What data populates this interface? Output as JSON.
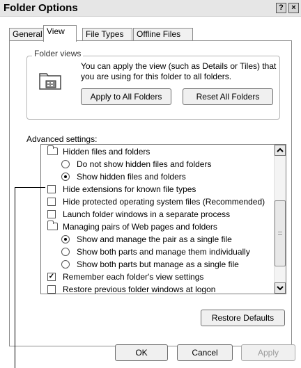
{
  "window": {
    "title": "Folder Options",
    "help_icon": "question-mark",
    "close_icon": "x"
  },
  "tabs": [
    {
      "label": "General",
      "active": false
    },
    {
      "label": "View",
      "active": true
    },
    {
      "label": "File Types",
      "active": false
    },
    {
      "label": "Offline Files",
      "active": false
    }
  ],
  "folder_views": {
    "legend": "Folder views",
    "description": "You can apply the view (such as Details or Tiles) that you are using for this folder to all folders.",
    "apply_all_label": "Apply to All Folders",
    "reset_all_label": "Reset All Folders",
    "icon": "folder-views-icon"
  },
  "advanced": {
    "label": "Advanced settings:",
    "items": [
      {
        "type": "folder",
        "label": "Hidden files and folders",
        "checked": false
      },
      {
        "type": "radio",
        "label": "Do not show hidden files and folders",
        "checked": false
      },
      {
        "type": "radio",
        "label": "Show hidden files and folders",
        "checked": true
      },
      {
        "type": "checkbox",
        "label": "Hide extensions for known file types",
        "checked": false
      },
      {
        "type": "checkbox",
        "label": "Hide protected operating system files (Recommended)",
        "checked": false
      },
      {
        "type": "checkbox",
        "label": "Launch folder windows in a separate process",
        "checked": false
      },
      {
        "type": "folder",
        "label": "Managing pairs of Web pages and folders",
        "checked": false
      },
      {
        "type": "radio",
        "label": "Show and manage the pair as a single file",
        "checked": true
      },
      {
        "type": "radio",
        "label": "Show both parts and manage them individually",
        "checked": false
      },
      {
        "type": "radio",
        "label": "Show both parts but manage as a single file",
        "checked": false
      },
      {
        "type": "checkbox",
        "label": "Remember each folder's view settings",
        "checked": true
      },
      {
        "type": "checkbox",
        "label": "Restore previous folder windows at logon",
        "checked": false
      }
    ],
    "restore_defaults_label": "Restore Defaults"
  },
  "footer": {
    "ok_label": "OK",
    "cancel_label": "Cancel",
    "apply_label": "Apply"
  }
}
